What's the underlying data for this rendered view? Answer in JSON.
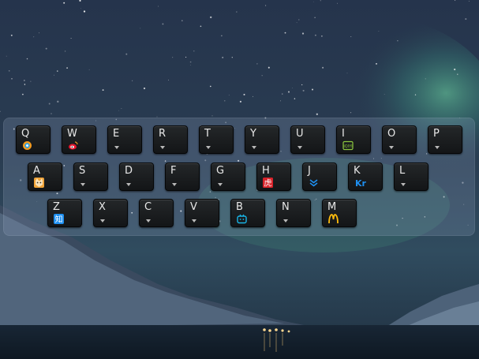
{
  "keyboard": {
    "rows": [
      [
        {
          "label": "Q",
          "icon": "qq-browser-icon"
        },
        {
          "label": "W",
          "icon": "weibo-icon"
        },
        {
          "label": "E",
          "icon": "chevron-down-icon"
        },
        {
          "label": "R",
          "icon": "chevron-down-icon"
        },
        {
          "label": "T",
          "icon": "chevron-down-icon"
        },
        {
          "label": "Y",
          "icon": "chevron-down-icon"
        },
        {
          "label": "U",
          "icon": "chevron-down-icon"
        },
        {
          "label": "I",
          "icon": "iqiyi-icon"
        },
        {
          "label": "O",
          "icon": "chevron-down-icon"
        },
        {
          "label": "P",
          "icon": "chevron-down-icon"
        }
      ],
      [
        {
          "label": "A",
          "icon": "fox-icon"
        },
        {
          "label": "S",
          "icon": "chevron-down-icon"
        },
        {
          "label": "D",
          "icon": "chevron-down-icon"
        },
        {
          "label": "F",
          "icon": "chevron-down-icon"
        },
        {
          "label": "G",
          "icon": "chevron-down-icon"
        },
        {
          "label": "H",
          "icon": "red-square-icon"
        },
        {
          "label": "J",
          "icon": "blue-chevrons-icon"
        },
        {
          "label": "K",
          "icon": "kr-icon"
        },
        {
          "label": "L",
          "icon": "chevron-down-icon"
        }
      ],
      [
        {
          "label": "Z",
          "icon": "zhihu-icon"
        },
        {
          "label": "X",
          "icon": "chevron-down-icon"
        },
        {
          "label": "C",
          "icon": "chevron-down-icon"
        },
        {
          "label": "V",
          "icon": "chevron-down-icon"
        },
        {
          "label": "B",
          "icon": "bilibili-icon"
        },
        {
          "label": "N",
          "icon": "chevron-down-icon"
        },
        {
          "label": "M",
          "icon": "mcdonalds-icon"
        }
      ]
    ]
  },
  "icon_text": {
    "zhihu": "知",
    "kr": "Kr",
    "red_square": "虎",
    "iqiyi": "iQIYI",
    "mcdonalds": "M"
  },
  "colors": {
    "accent_blue": "#1e8ff0",
    "weibo_red": "#e6162d",
    "iqiyi_green": "#8cc63f",
    "mcd_yellow": "#ffbc0d"
  }
}
